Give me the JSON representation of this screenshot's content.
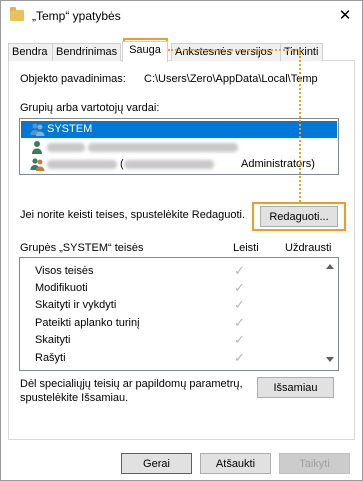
{
  "window": {
    "title": "„Temp“ ypatybės",
    "close": "✕"
  },
  "tabs": [
    {
      "label": "Bendra"
    },
    {
      "label": "Bendrinimas"
    },
    {
      "label": "Sauga"
    },
    {
      "label": "Ankstesnės versijos"
    },
    {
      "label": "Tinkinti"
    }
  ],
  "object": {
    "label": "Objekto pavadinimas:",
    "value": "C:\\Users\\Zero\\AppData\\Local\\Temp"
  },
  "groups": {
    "label": "Grupių arba vartotojų vardai:",
    "items": [
      {
        "name": "SYSTEM",
        "selected": true
      },
      {
        "name": "",
        "detail": "",
        "selected": false
      },
      {
        "name": "",
        "detail": "Administrators)",
        "selected": false
      }
    ]
  },
  "edit": {
    "prompt": "Jei norite keisti teises, spustelėkite Redaguoti.",
    "button": "Redaguoti..."
  },
  "permissions": {
    "title": "Grupės „SYSTEM“ teisės",
    "allow": "Leisti",
    "deny": "Uždrausti",
    "rows": [
      {
        "name": "Visos teisės",
        "allow": true
      },
      {
        "name": "Modifikuoti",
        "allow": true
      },
      {
        "name": "Skaityti ir vykdyti",
        "allow": true
      },
      {
        "name": "Pateikti aplanko turinį",
        "allow": true
      },
      {
        "name": "Skaityti",
        "allow": true
      },
      {
        "name": "Rašyti",
        "allow": true
      }
    ]
  },
  "advanced": {
    "line1": "Dėl specialiųjų teisių ar papildomų parametrų,",
    "line2": "spustelėkite Išsamiau.",
    "button": "Išsamiau"
  },
  "footer": {
    "ok": "Gerai",
    "cancel": "Atšaukti",
    "apply": "Taikyti"
  },
  "colors": {
    "highlight": "#f39c1f",
    "selection": "#0078d7"
  }
}
